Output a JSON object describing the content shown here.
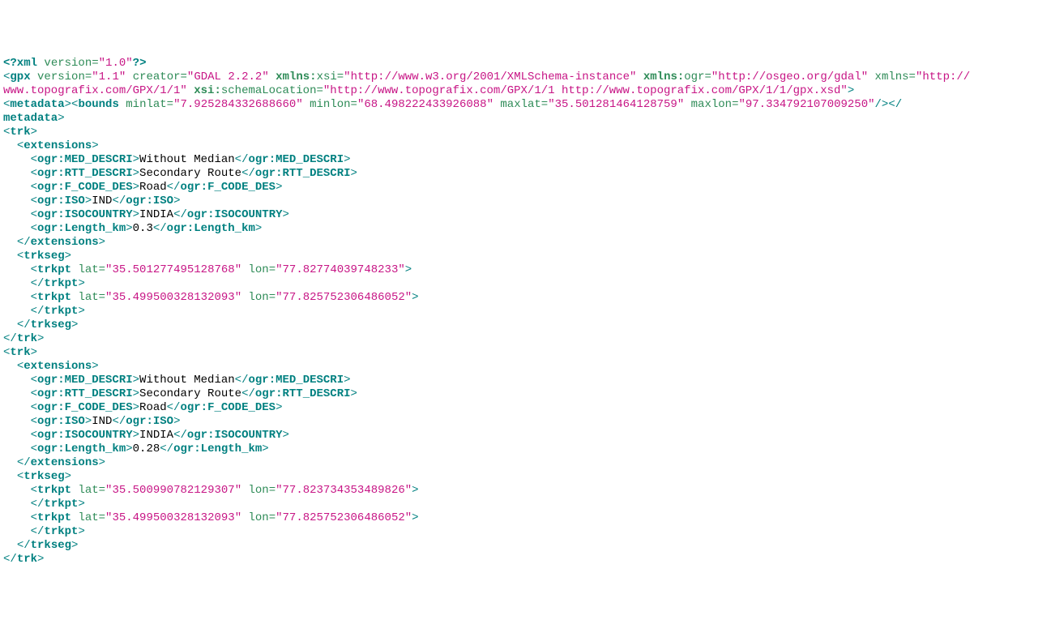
{
  "xmlDecl": {
    "version": "1.0"
  },
  "gpx": {
    "version": "1.1",
    "creator": "GDAL 2.2.2",
    "xmlnsXsi": "http://www.w3.org/2001/XMLSchema-instance",
    "xmlnsOgr": "http://osgeo.org/gdal",
    "xmlns": "http://www.topografix.com/GPX/1/1",
    "schemaLocation": "http://www.topografix.com/GPX/1/1 http://www.topografix.com/GPX/1/1/gpx.xsd"
  },
  "bounds": {
    "minlat": "7.925284332688660",
    "minlon": "68.498222433926088",
    "maxlat": "35.501281464128759",
    "maxlon": "97.334792107009250"
  },
  "trk1": {
    "ext": {
      "MED_DESCRI": "Without Median",
      "RTT_DESCRI": "Secondary Route",
      "F_CODE_DES": "Road",
      "ISO": "IND",
      "ISOCOUNTRY": "INDIA",
      "Length_km": "0.3"
    },
    "pt1": {
      "lat": "35.501277495128768",
      "lon": "77.82774039748233"
    },
    "pt2": {
      "lat": "35.499500328132093",
      "lon": "77.825752306486052"
    }
  },
  "trk2": {
    "ext": {
      "MED_DESCRI": "Without Median",
      "RTT_DESCRI": "Secondary Route",
      "F_CODE_DES": "Road",
      "ISO": "IND",
      "ISOCOUNTRY": "INDIA",
      "Length_km": "0.28"
    },
    "pt1": {
      "lat": "35.500990782129307",
      "lon": "77.823734353489826"
    },
    "pt2": {
      "lat": "35.499500328132093",
      "lon": "77.825752306486052"
    }
  }
}
